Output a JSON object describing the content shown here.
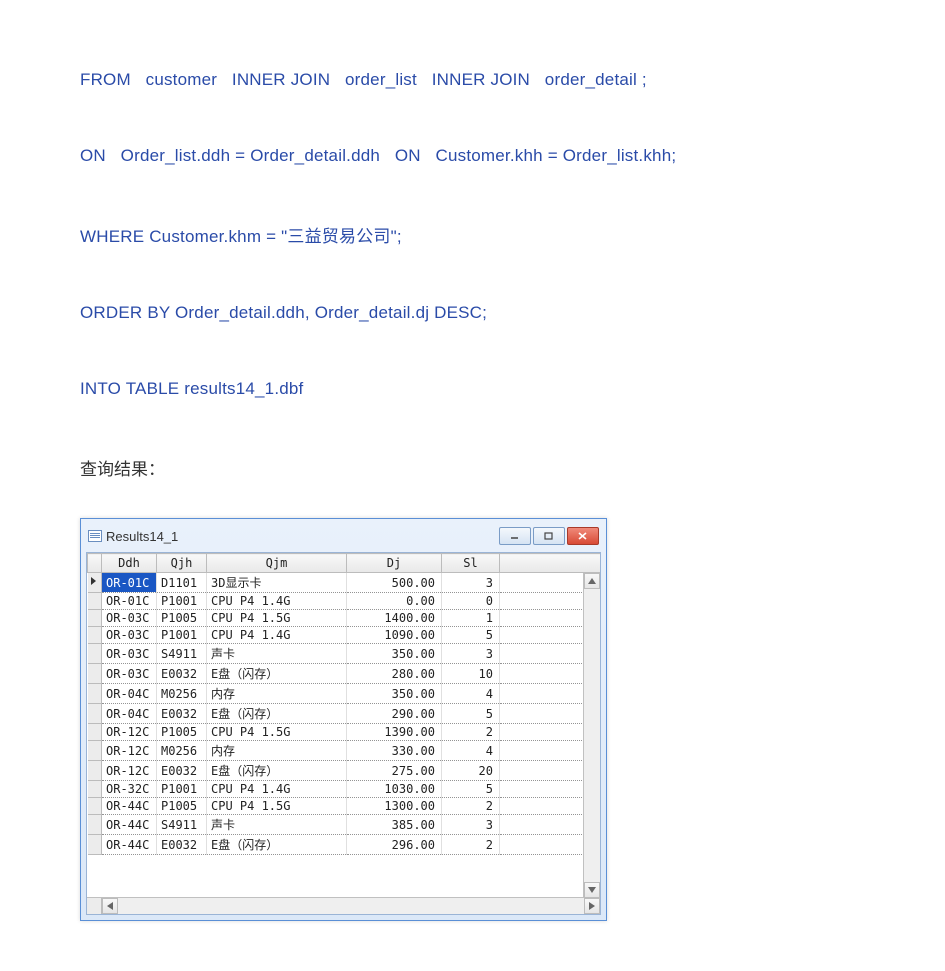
{
  "sql": {
    "line1": "FROM   customer   INNER JOIN   order_list   INNER JOIN   order_detail ;",
    "line2": "ON   Order_list.ddh = Order_detail.ddh   ON   Customer.khh = Order_list.khh;",
    "line3": "WHERE Customer.khm = \"三益贸易公司\";",
    "line4": "ORDER BY Order_detail.ddh, Order_detail.dj DESC;",
    "line5": "INTO TABLE results14_1.dbf"
  },
  "result_label": "查询结果：",
  "window": {
    "title": "Results14_1"
  },
  "columns": {
    "ddh": "Ddh",
    "qjh": "Qjh",
    "qjm": "Qjm",
    "dj": "Dj",
    "sl": "Sl"
  },
  "rows": [
    {
      "ddh": "OR-01C",
      "qjh": "D1101",
      "qjm": "3D显示卡",
      "dj": "500.00",
      "sl": "3"
    },
    {
      "ddh": "OR-01C",
      "qjh": "P1001",
      "qjm": "CPU P4 1.4G",
      "dj": "0.00",
      "sl": "0"
    },
    {
      "ddh": "OR-03C",
      "qjh": "P1005",
      "qjm": "CPU P4 1.5G",
      "dj": "1400.00",
      "sl": "1"
    },
    {
      "ddh": "OR-03C",
      "qjh": "P1001",
      "qjm": "CPU P4 1.4G",
      "dj": "1090.00",
      "sl": "5"
    },
    {
      "ddh": "OR-03C",
      "qjh": "S4911",
      "qjm": "声卡",
      "dj": "350.00",
      "sl": "3"
    },
    {
      "ddh": "OR-03C",
      "qjh": "E0032",
      "qjm": "E盘（闪存）",
      "dj": "280.00",
      "sl": "10"
    },
    {
      "ddh": "OR-04C",
      "qjh": "M0256",
      "qjm": "内存",
      "dj": "350.00",
      "sl": "4"
    },
    {
      "ddh": "OR-04C",
      "qjh": "E0032",
      "qjm": "E盘（闪存）",
      "dj": "290.00",
      "sl": "5"
    },
    {
      "ddh": "OR-12C",
      "qjh": "P1005",
      "qjm": "CPU P4 1.5G",
      "dj": "1390.00",
      "sl": "2"
    },
    {
      "ddh": "OR-12C",
      "qjh": "M0256",
      "qjm": "内存",
      "dj": "330.00",
      "sl": "4"
    },
    {
      "ddh": "OR-12C",
      "qjh": "E0032",
      "qjm": "E盘（闪存）",
      "dj": "275.00",
      "sl": "20"
    },
    {
      "ddh": "OR-32C",
      "qjh": "P1001",
      "qjm": "CPU P4 1.4G",
      "dj": "1030.00",
      "sl": "5"
    },
    {
      "ddh": "OR-44C",
      "qjh": "P1005",
      "qjm": "CPU P4 1.5G",
      "dj": "1300.00",
      "sl": "2"
    },
    {
      "ddh": "OR-44C",
      "qjh": "S4911",
      "qjm": "声卡",
      "dj": "385.00",
      "sl": "3"
    },
    {
      "ddh": "OR-44C",
      "qjh": "E0032",
      "qjm": "E盘（闪存）",
      "dj": "296.00",
      "sl": "2"
    }
  ]
}
